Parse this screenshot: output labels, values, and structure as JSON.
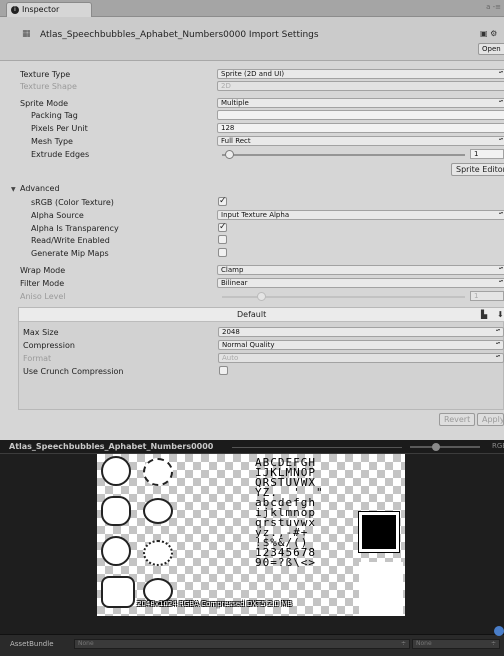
{
  "tab": {
    "title": "Inspector",
    "menu": "a -≡"
  },
  "header": {
    "title": "Atlas_Speechbubbles_Aphabet_Numbers0000 Import Settings",
    "open_label": "Open",
    "icons": "▣ ⚙"
  },
  "texture": {
    "texture_type_label": "Texture Type",
    "texture_type_value": "Sprite (2D and UI)",
    "texture_shape_label": "Texture Shape",
    "texture_shape_value": "2D",
    "sprite_mode_label": "Sprite Mode",
    "sprite_mode_value": "Multiple",
    "packing_tag_label": "Packing Tag",
    "packing_tag_value": "",
    "ppu_label": "Pixels Per Unit",
    "ppu_value": "128",
    "mesh_type_label": "Mesh Type",
    "mesh_type_value": "Full Rect",
    "extrude_label": "Extrude Edges",
    "extrude_value": "1",
    "extrude_fraction": 0.03,
    "sprite_editor_label": "Sprite Editor"
  },
  "advanced": {
    "label": "Advanced",
    "srgb_label": "sRGB (Color Texture)",
    "srgb_checked": true,
    "alpha_source_label": "Alpha Source",
    "alpha_source_value": "Input Texture Alpha",
    "alpha_transparency_label": "Alpha Is Transparency",
    "alpha_transparency_checked": true,
    "read_write_label": "Read/Write Enabled",
    "read_write_checked": false,
    "mipmaps_label": "Generate Mip Maps",
    "mipmaps_checked": false
  },
  "wrap": {
    "wrap_mode_label": "Wrap Mode",
    "wrap_mode_value": "Clamp",
    "filter_mode_label": "Filter Mode",
    "filter_mode_value": "Bilinear",
    "aniso_label": "Aniso Level",
    "aniso_value": "1",
    "aniso_fraction": 0.16
  },
  "platform": {
    "tab_label": "Default",
    "max_size_label": "Max Size",
    "max_size_value": "2048",
    "compression_label": "Compression",
    "compression_value": "Normal Quality",
    "format_label": "Format",
    "format_value": "Auto",
    "crunch_label": "Use Crunch Compression",
    "crunch_checked": false
  },
  "buttons": {
    "revert": "Revert",
    "apply": "Apply"
  },
  "preview": {
    "title": "Atlas_Speechbubbles_Aphabet_Numbers0000",
    "info": "2048x1024  RGBA Compressed DXT5  2.0 MB",
    "channel": "RGB",
    "glyphs": "ABCDEFGH\nIJKLMNOP\nQRSTUVWX\nYZ.  '  \"\nabcdefgh\nijklmnop\nqrstuvwx\nyz.,-#+\n!$%&/()\n12345678\n90=?ß\\<>"
  },
  "asset_bundle": {
    "label": "AssetBundle",
    "bundle_value": "None",
    "variant_value": "None"
  },
  "colors": {
    "panel": "#d6d6d6",
    "preview_bg": "#1e1e1e",
    "asset_bar": "#2a2a2a"
  }
}
